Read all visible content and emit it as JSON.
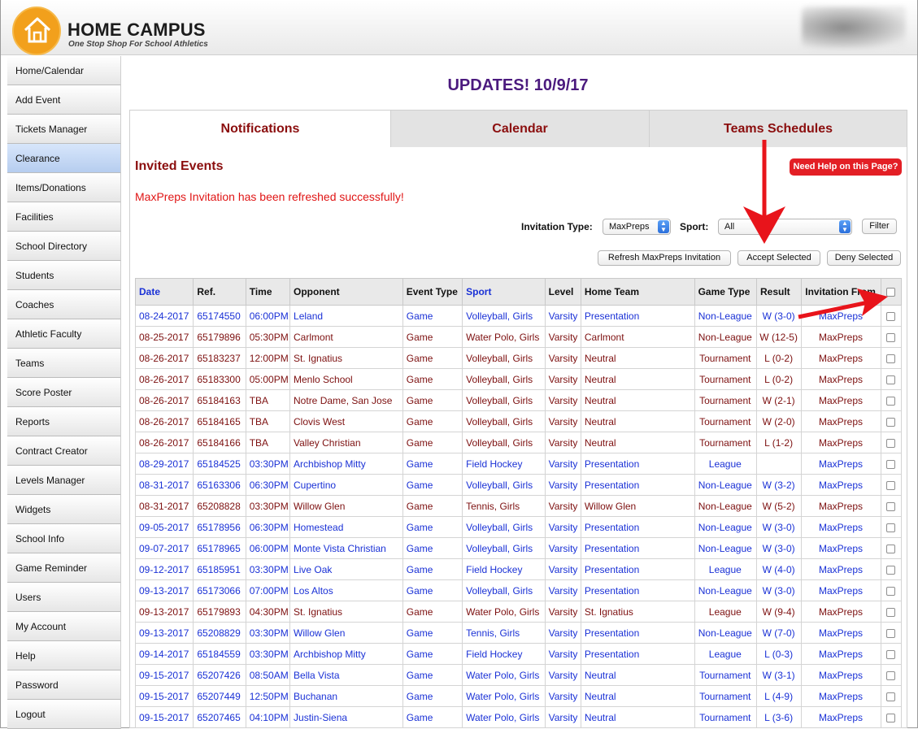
{
  "header": {
    "brand_title": "HOME CAMPUS",
    "brand_subtitle": "One Stop Shop For School Athletics"
  },
  "sidebar": {
    "items": [
      {
        "label": "Home/Calendar"
      },
      {
        "label": "Add Event"
      },
      {
        "label": "Tickets Manager"
      },
      {
        "label": "Clearance",
        "active": true
      },
      {
        "label": "Items/Donations"
      },
      {
        "label": "Facilities"
      },
      {
        "label": "School Directory"
      },
      {
        "label": "Students"
      },
      {
        "label": "Coaches"
      },
      {
        "label": "Athletic Faculty"
      },
      {
        "label": "Teams"
      },
      {
        "label": "Score Poster"
      },
      {
        "label": "Reports"
      },
      {
        "label": "Contract Creator"
      },
      {
        "label": "Levels Manager"
      },
      {
        "label": "Widgets"
      },
      {
        "label": "School Info"
      },
      {
        "label": "Game Reminder"
      },
      {
        "label": "Users"
      },
      {
        "label": "My Account"
      },
      {
        "label": "Help"
      },
      {
        "label": "Password"
      },
      {
        "label": "Logout"
      }
    ]
  },
  "main": {
    "title": "UPDATES! 10/9/17",
    "tabs": [
      {
        "label": "Notifications"
      },
      {
        "label": "Calendar"
      },
      {
        "label": "Teams Schedules"
      }
    ],
    "section_title": "Invited Events",
    "help_button": "Need Help on this Page?",
    "success_message": "MaxPreps Invitation has been refreshed successfully!",
    "filters": {
      "invitation_type_label": "Invitation Type:",
      "invitation_type_value": "MaxPreps",
      "sport_label": "Sport:",
      "sport_value": "All",
      "filter_button": "Filter"
    },
    "actions": {
      "refresh": "Refresh MaxPreps Invitation",
      "accept": "Accept Selected",
      "deny": "Deny Selected"
    }
  },
  "table": {
    "headers": [
      "Date",
      "Ref.",
      "Time",
      "Opponent",
      "Event Type",
      "Sport",
      "Level",
      "Home Team",
      "Game Type",
      "Result",
      "Invitation From"
    ],
    "rows": [
      {
        "color": "blue",
        "cells": [
          "08-24-2017",
          "65174550",
          "06:00PM",
          "Leland",
          "Game",
          "Volleyball, Girls",
          "Varsity",
          "Presentation",
          "Non-League",
          "W (3-0)",
          "MaxPreps"
        ]
      },
      {
        "color": "maroon",
        "cells": [
          "08-25-2017",
          "65179896",
          "05:30PM",
          "Carlmont",
          "Game",
          "Water Polo, Girls",
          "Varsity",
          "Carlmont",
          "Non-League",
          "W (12-5)",
          "MaxPreps"
        ]
      },
      {
        "color": "maroon",
        "cells": [
          "08-26-2017",
          "65183237",
          "12:00PM",
          "St. Ignatius",
          "Game",
          "Volleyball, Girls",
          "Varsity",
          "Neutral",
          "Tournament",
          "L (0-2)",
          "MaxPreps"
        ]
      },
      {
        "color": "maroon",
        "cells": [
          "08-26-2017",
          "65183300",
          "05:00PM",
          "Menlo School",
          "Game",
          "Volleyball, Girls",
          "Varsity",
          "Neutral",
          "Tournament",
          "L (0-2)",
          "MaxPreps"
        ]
      },
      {
        "color": "maroon",
        "cells": [
          "08-26-2017",
          "65184163",
          "TBA",
          "Notre Dame, San Jose",
          "Game",
          "Volleyball, Girls",
          "Varsity",
          "Neutral",
          "Tournament",
          "W (2-1)",
          "MaxPreps"
        ]
      },
      {
        "color": "maroon",
        "cells": [
          "08-26-2017",
          "65184165",
          "TBA",
          "Clovis West",
          "Game",
          "Volleyball, Girls",
          "Varsity",
          "Neutral",
          "Tournament",
          "W (2-0)",
          "MaxPreps"
        ]
      },
      {
        "color": "maroon",
        "cells": [
          "08-26-2017",
          "65184166",
          "TBA",
          "Valley Christian",
          "Game",
          "Volleyball, Girls",
          "Varsity",
          "Neutral",
          "Tournament",
          "L (1-2)",
          "MaxPreps"
        ]
      },
      {
        "color": "blue",
        "cells": [
          "08-29-2017",
          "65184525",
          "03:30PM",
          "Archbishop Mitty",
          "Game",
          "Field Hockey",
          "Varsity",
          "Presentation",
          "League",
          "",
          "MaxPreps"
        ]
      },
      {
        "color": "blue",
        "cells": [
          "08-31-2017",
          "65163306",
          "06:30PM",
          "Cupertino",
          "Game",
          "Volleyball, Girls",
          "Varsity",
          "Presentation",
          "Non-League",
          "W (3-2)",
          "MaxPreps"
        ]
      },
      {
        "color": "maroon",
        "cells": [
          "08-31-2017",
          "65208828",
          "03:30PM",
          "Willow Glen",
          "Game",
          "Tennis, Girls",
          "Varsity",
          "Willow Glen",
          "Non-League",
          "W (5-2)",
          "MaxPreps"
        ]
      },
      {
        "color": "blue",
        "cells": [
          "09-05-2017",
          "65178956",
          "06:30PM",
          "Homestead",
          "Game",
          "Volleyball, Girls",
          "Varsity",
          "Presentation",
          "Non-League",
          "W (3-0)",
          "MaxPreps"
        ]
      },
      {
        "color": "blue",
        "cells": [
          "09-07-2017",
          "65178965",
          "06:00PM",
          "Monte Vista Christian",
          "Game",
          "Volleyball, Girls",
          "Varsity",
          "Presentation",
          "Non-League",
          "W (3-0)",
          "MaxPreps"
        ]
      },
      {
        "color": "blue",
        "cells": [
          "09-12-2017",
          "65185951",
          "03:30PM",
          "Live Oak",
          "Game",
          "Field Hockey",
          "Varsity",
          "Presentation",
          "League",
          "W (4-0)",
          "MaxPreps"
        ]
      },
      {
        "color": "blue",
        "cells": [
          "09-13-2017",
          "65173066",
          "07:00PM",
          "Los Altos",
          "Game",
          "Volleyball, Girls",
          "Varsity",
          "Presentation",
          "Non-League",
          "W (3-0)",
          "MaxPreps"
        ]
      },
      {
        "color": "maroon",
        "cells": [
          "09-13-2017",
          "65179893",
          "04:30PM",
          "St. Ignatius",
          "Game",
          "Water Polo, Girls",
          "Varsity",
          "St. Ignatius",
          "League",
          "W (9-4)",
          "MaxPreps"
        ]
      },
      {
        "color": "blue",
        "cells": [
          "09-13-2017",
          "65208829",
          "03:30PM",
          "Willow Glen",
          "Game",
          "Tennis, Girls",
          "Varsity",
          "Presentation",
          "Non-League",
          "W (7-0)",
          "MaxPreps"
        ]
      },
      {
        "color": "blue",
        "cells": [
          "09-14-2017",
          "65184559",
          "03:30PM",
          "Archbishop Mitty",
          "Game",
          "Field Hockey",
          "Varsity",
          "Presentation",
          "League",
          "L (0-3)",
          "MaxPreps"
        ]
      },
      {
        "color": "blue",
        "cells": [
          "09-15-2017",
          "65207426",
          "08:50AM",
          "Bella Vista",
          "Game",
          "Water Polo, Girls",
          "Varsity",
          "Neutral",
          "Tournament",
          "W (3-1)",
          "MaxPreps"
        ]
      },
      {
        "color": "blue",
        "cells": [
          "09-15-2017",
          "65207449",
          "12:50PM",
          "Buchanan",
          "Game",
          "Water Polo, Girls",
          "Varsity",
          "Neutral",
          "Tournament",
          "L (4-9)",
          "MaxPreps"
        ]
      },
      {
        "color": "blue",
        "cells": [
          "09-15-2017",
          "65207465",
          "04:10PM",
          "Justin-Siena",
          "Game",
          "Water Polo, Girls",
          "Varsity",
          "Neutral",
          "Tournament",
          "L (3-6)",
          "MaxPreps"
        ]
      }
    ]
  },
  "colors": {
    "accent_maroon": "#8b0e0e",
    "title_purple": "#4b1a7e",
    "link_blue": "#1a31d6",
    "alert_red": "#e01515",
    "arrow_red": "#e8141b",
    "logo_orange": "#f2a01c"
  }
}
